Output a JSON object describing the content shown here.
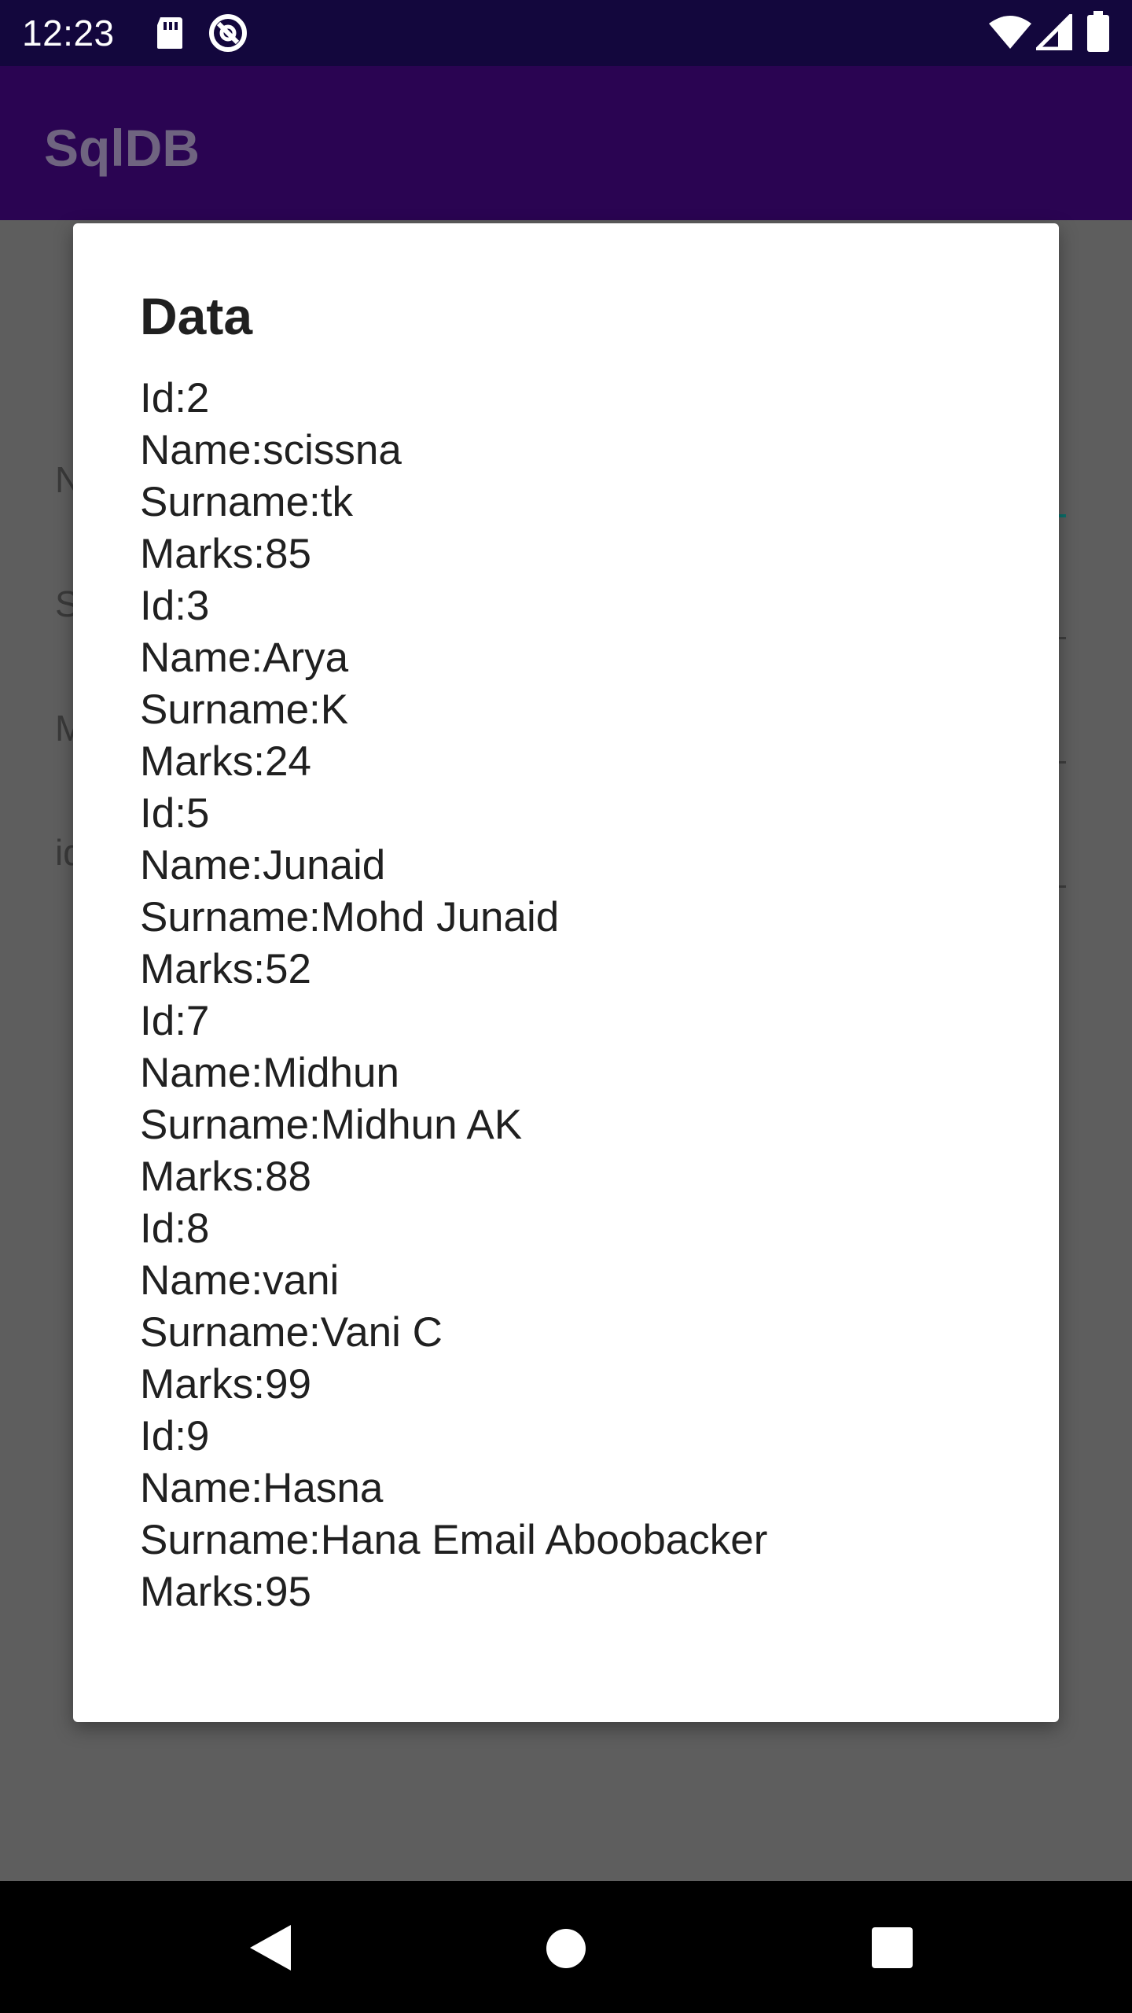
{
  "status_bar": {
    "time": "12:23",
    "icons": [
      "sd-card-icon",
      "data-saver-icon",
      "wifi-icon",
      "signal-icon",
      "battery-icon"
    ]
  },
  "app_bar": {
    "title": "SqlDB"
  },
  "background_form": {
    "labels": [
      "N",
      "S",
      "M",
      "id"
    ]
  },
  "dialog": {
    "title": "Data",
    "lines": [
      "Id:2",
      "Name:scissna",
      "Surname:tk",
      "Marks:85",
      "Id:3",
      "Name:Arya",
      "Surname:K",
      "Marks:24",
      "Id:5",
      "Name:Junaid",
      "Surname:Mohd Junaid",
      "Marks:52",
      "Id:7",
      "Name:Midhun",
      "Surname:Midhun AK",
      "Marks:88",
      "Id:8",
      "Name:vani",
      "Surname:Vani C",
      "Marks:99",
      "Id:9",
      "Name:Hasna",
      "Surname:Hana Email Aboobacker",
      "Marks:95"
    ]
  },
  "nav_bar": {
    "buttons": [
      "back-icon",
      "home-icon",
      "recents-icon"
    ]
  },
  "colors": {
    "status_bar": "#13073d",
    "app_bar": "#2a0452",
    "scrim": "#5e5e5e",
    "dialog": "#ffffff",
    "accent": "#0b6f6a"
  }
}
